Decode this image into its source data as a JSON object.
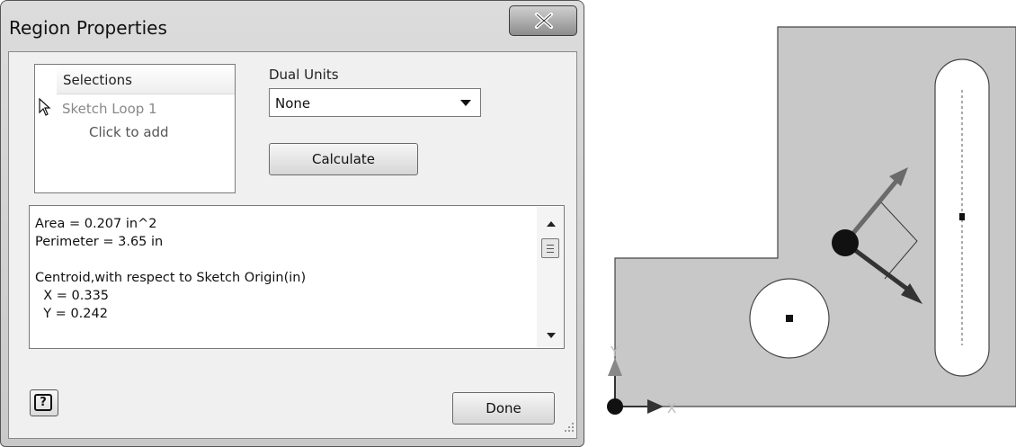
{
  "dialog": {
    "title": "Region Properties",
    "close_glyph": "X",
    "selections": {
      "header": "Selections",
      "items": [
        "Sketch Loop 1"
      ],
      "add_hint": "Click to add"
    },
    "dual_units": {
      "label": "Dual Units",
      "selected": "None"
    },
    "calculate_label": "Calculate",
    "results": [
      "Area = 0.207 in^2",
      "Perimeter = 3.65 in",
      "",
      "Centroid,with respect to Sketch Origin(in)",
      "  X = 0.335",
      "  Y = 0.242"
    ],
    "help_glyph": "?",
    "done_label": "Done"
  },
  "sketch": {
    "axis_y_label": "Y",
    "axis_x_label": "X"
  },
  "icons": {
    "close": "close-icon",
    "cursor": "mouse-cursor-icon",
    "help": "help-icon",
    "resize": "resize-grip-icon"
  }
}
